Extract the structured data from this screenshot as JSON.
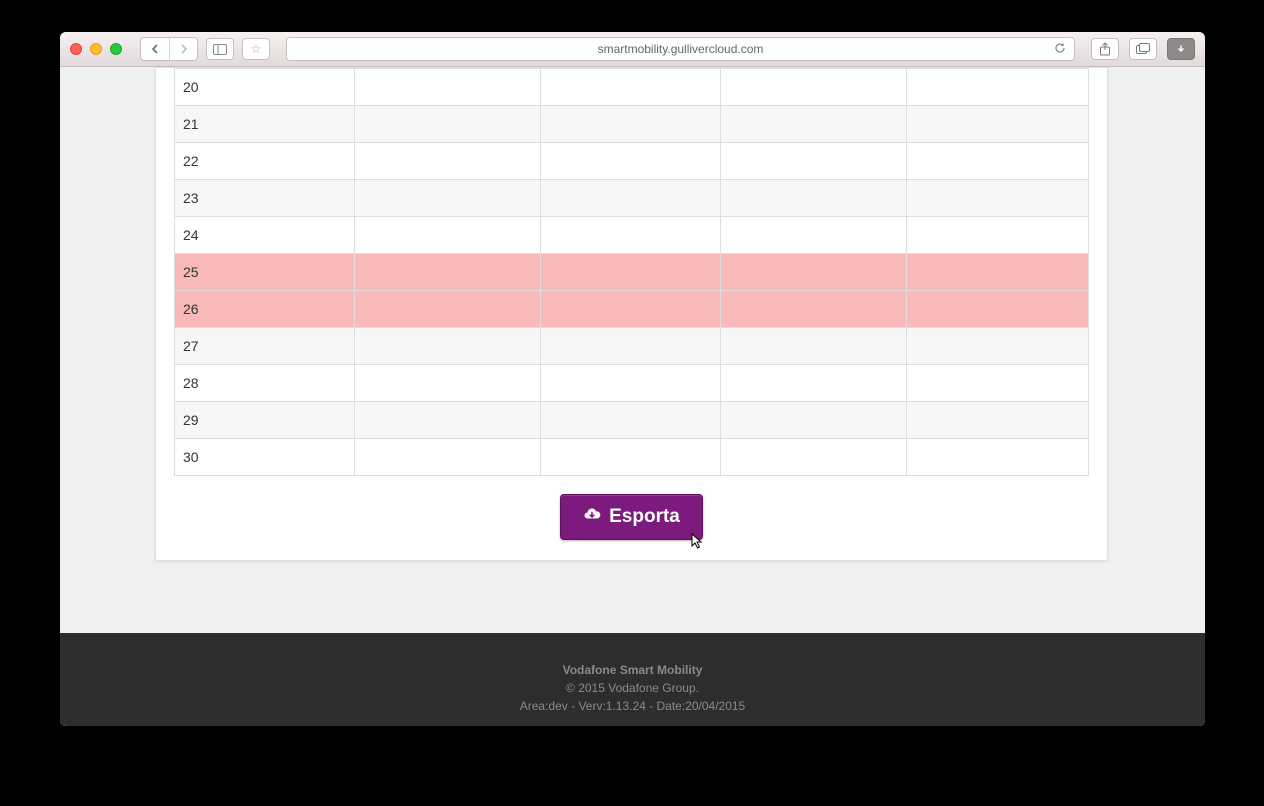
{
  "browser": {
    "url": "smartmobility.gullivercloud.com"
  },
  "table": {
    "rows": [
      {
        "day": "20",
        "c2": "",
        "c3": "",
        "c4": "",
        "c5": "",
        "highlight": false,
        "odd": false
      },
      {
        "day": "21",
        "c2": "",
        "c3": "",
        "c4": "",
        "c5": "",
        "highlight": false,
        "odd": true
      },
      {
        "day": "22",
        "c2": "",
        "c3": "",
        "c4": "",
        "c5": "",
        "highlight": false,
        "odd": false
      },
      {
        "day": "23",
        "c2": "",
        "c3": "",
        "c4": "",
        "c5": "",
        "highlight": false,
        "odd": true
      },
      {
        "day": "24",
        "c2": "",
        "c3": "",
        "c4": "",
        "c5": "",
        "highlight": false,
        "odd": false
      },
      {
        "day": "25",
        "c2": "",
        "c3": "",
        "c4": "",
        "c5": "",
        "highlight": true,
        "odd": true
      },
      {
        "day": "26",
        "c2": "",
        "c3": "",
        "c4": "",
        "c5": "",
        "highlight": true,
        "odd": false
      },
      {
        "day": "27",
        "c2": "",
        "c3": "",
        "c4": "",
        "c5": "",
        "highlight": false,
        "odd": true
      },
      {
        "day": "28",
        "c2": "",
        "c3": "",
        "c4": "",
        "c5": "",
        "highlight": false,
        "odd": false
      },
      {
        "day": "29",
        "c2": "",
        "c3": "",
        "c4": "",
        "c5": "",
        "highlight": false,
        "odd": true
      },
      {
        "day": "30",
        "c2": "",
        "c3": "",
        "c4": "",
        "c5": "",
        "highlight": false,
        "odd": false
      }
    ]
  },
  "actions": {
    "export_label": "Esporta"
  },
  "footer": {
    "line1": "Vodafone Smart Mobility",
    "line2": "© 2015 Vodafone Group.",
    "line3": "Area:dev - Verv:1.13.24 - Date:20/04/2015"
  }
}
